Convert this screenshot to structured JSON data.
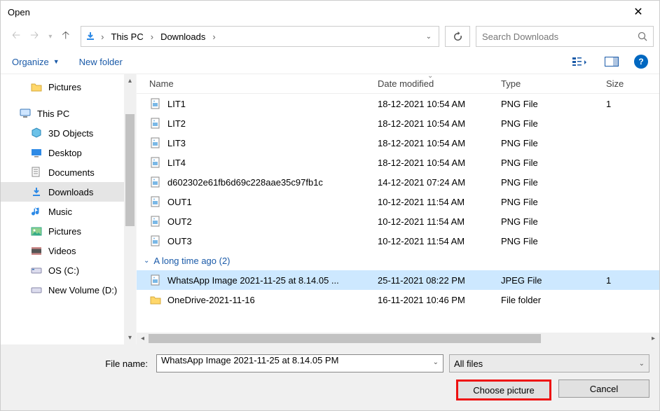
{
  "title": "Open",
  "breadcrumb": {
    "root": "This PC",
    "folder": "Downloads"
  },
  "search_placeholder": "Search Downloads",
  "toolbar": {
    "organize": "Organize",
    "new_folder": "New folder"
  },
  "sidebar": {
    "items": [
      {
        "label": "Pictures",
        "icon": "folder"
      },
      {
        "label": "This PC",
        "icon": "pc"
      },
      {
        "label": "3D Objects",
        "icon": "3d"
      },
      {
        "label": "Desktop",
        "icon": "desktop"
      },
      {
        "label": "Documents",
        "icon": "documents"
      },
      {
        "label": "Downloads",
        "icon": "downloads"
      },
      {
        "label": "Music",
        "icon": "music"
      },
      {
        "label": "Pictures",
        "icon": "pictures"
      },
      {
        "label": "Videos",
        "icon": "videos"
      },
      {
        "label": "OS (C:)",
        "icon": "drive"
      },
      {
        "label": "New Volume (D:)",
        "icon": "drive"
      }
    ]
  },
  "columns": {
    "name": "Name",
    "date": "Date modified",
    "type": "Type",
    "size": "Size"
  },
  "files": [
    {
      "name": "LIT1",
      "date": "18-12-2021 10:54 AM",
      "type": "PNG File",
      "size": "1",
      "icon": "image"
    },
    {
      "name": "LIT2",
      "date": "18-12-2021 10:54 AM",
      "type": "PNG File",
      "size": "",
      "icon": "image"
    },
    {
      "name": "LIT3",
      "date": "18-12-2021 10:54 AM",
      "type": "PNG File",
      "size": "",
      "icon": "image"
    },
    {
      "name": "LIT4",
      "date": "18-12-2021 10:54 AM",
      "type": "PNG File",
      "size": "",
      "icon": "image"
    },
    {
      "name": "d602302e61fb6d69c228aae35c97fb1c",
      "date": "14-12-2021 07:24 AM",
      "type": "PNG File",
      "size": "",
      "icon": "image"
    },
    {
      "name": "OUT1",
      "date": "10-12-2021 11:54 AM",
      "type": "PNG File",
      "size": "",
      "icon": "image"
    },
    {
      "name": "OUT2",
      "date": "10-12-2021 11:54 AM",
      "type": "PNG File",
      "size": "",
      "icon": "image"
    },
    {
      "name": "OUT3",
      "date": "10-12-2021 11:54 AM",
      "type": "PNG File",
      "size": "",
      "icon": "image"
    }
  ],
  "group_label": "A long time ago (2)",
  "files2": [
    {
      "name": "WhatsApp Image 2021-11-25 at 8.14.05 ...",
      "date": "25-11-2021 08:22 PM",
      "type": "JPEG File",
      "size": "1",
      "icon": "image",
      "selected": true
    },
    {
      "name": "OneDrive-2021-11-16",
      "date": "16-11-2021 10:46 PM",
      "type": "File folder",
      "size": "",
      "icon": "folder"
    }
  ],
  "file_name_label": "File name:",
  "file_name_value": "WhatsApp Image 2021-11-25 at 8.14.05 PM",
  "file_type_value": "All files",
  "buttons": {
    "choose": "Choose picture",
    "cancel": "Cancel"
  }
}
